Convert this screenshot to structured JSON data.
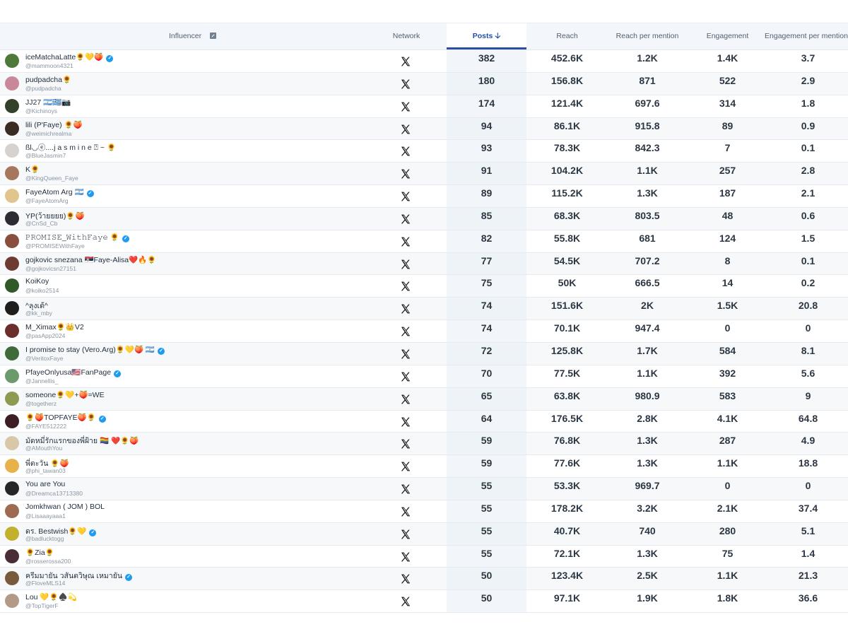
{
  "columns": {
    "influencer": "Influencer",
    "network": "Network",
    "posts": "Posts",
    "reach": "Reach",
    "reach_per_mention": "Reach per mention",
    "engagement": "Engagement",
    "engagement_per_mention": "Engagement per mention"
  },
  "sort": {
    "column": "posts",
    "direction": "desc"
  },
  "colors": {
    "accent": "#2b4f9e",
    "verified": "#1d9bf0"
  },
  "rows": [
    {
      "name": "iceMatchaLatte🌻💛🍑",
      "handle": "@mammoon4321",
      "verified": true,
      "posts": "382",
      "reach": "452.6K",
      "rpm": "1.2K",
      "eng": "1.4K",
      "epm": "3.7",
      "avatar": "#4d7a3a"
    },
    {
      "name": "pudpadcha🌻",
      "handle": "@pudpadcha",
      "verified": false,
      "posts": "180",
      "reach": "156.8K",
      "rpm": "871",
      "eng": "522",
      "epm": "2.9",
      "avatar": "#c9879a"
    },
    {
      "name": "JJ27 🇦🇷🇬🇷📷",
      "handle": "@Kichinoys",
      "verified": false,
      "posts": "174",
      "reach": "121.4K",
      "rpm": "697.6",
      "eng": "314",
      "epm": "1.8",
      "avatar": "#33402a"
    },
    {
      "name": "lili (P'Faye) 🌻🍑",
      "handle": "@weimichrealma",
      "verified": false,
      "posts": "94",
      "reach": "86.1K",
      "rpm": "915.8",
      "eng": "89",
      "epm": "0.9",
      "avatar": "#3a2b25"
    },
    {
      "name": "ßl◡ⓔ....j a s m i n e ⍰ ~ 🌻",
      "handle": "@BlueJasmin7",
      "verified": false,
      "posts": "93",
      "reach": "78.3K",
      "rpm": "842.3",
      "eng": "7",
      "epm": "0.1",
      "avatar": "#d5d2cf"
    },
    {
      "name": "K🌻",
      "handle": "@KingQueen_Faye",
      "verified": false,
      "posts": "91",
      "reach": "104.2K",
      "rpm": "1.1K",
      "eng": "257",
      "epm": "2.8",
      "avatar": "#a5775d"
    },
    {
      "name": "FayeAtom Arg 🇦🇷",
      "handle": "@FayeAtomArg",
      "verified": true,
      "posts": "89",
      "reach": "115.2K",
      "rpm": "1.3K",
      "eng": "187",
      "epm": "2.1",
      "avatar": "#e2c58d"
    },
    {
      "name": "YP(ว้ายยยย)🌻🍑",
      "handle": "@CnSd_Cb",
      "verified": false,
      "posts": "85",
      "reach": "68.3K",
      "rpm": "803.5",
      "eng": "48",
      "epm": "0.6",
      "avatar": "#2c2a33"
    },
    {
      "name": "𝙿𝚁𝙾𝙼𝙸𝚂𝙴_𝚆𝚒𝚝𝚑𝙵𝚊𝚢𝚎 🌻",
      "handle": "@PROMISEWithFaye",
      "verified": true,
      "posts": "82",
      "reach": "55.8K",
      "rpm": "681",
      "eng": "124",
      "epm": "1.5",
      "avatar": "#8a4f3c"
    },
    {
      "name": "gojkovic snezana 🇷🇸Faye-Alisa❤️🔥🌻",
      "handle": "@gojkovicsn27151",
      "verified": false,
      "posts": "77",
      "reach": "54.5K",
      "rpm": "707.2",
      "eng": "8",
      "epm": "0.1",
      "avatar": "#6e3b33"
    },
    {
      "name": "KoiKoy",
      "handle": "@koiko2514",
      "verified": false,
      "posts": "75",
      "reach": "50K",
      "rpm": "666.5",
      "eng": "14",
      "epm": "0.2",
      "avatar": "#2f5a28"
    },
    {
      "name": "^ลุงเต้^",
      "handle": "@kk_mby",
      "verified": false,
      "posts": "74",
      "reach": "151.6K",
      "rpm": "2K",
      "eng": "1.5K",
      "epm": "20.8",
      "avatar": "#1f1d1c"
    },
    {
      "name": "M_Ximax🌻👑V2",
      "handle": "@pasApp2024",
      "verified": false,
      "posts": "74",
      "reach": "70.1K",
      "rpm": "947.4",
      "eng": "0",
      "epm": "0",
      "avatar": "#6a2f2c"
    },
    {
      "name": "I promise to stay (Vero.Arg)🌻💛🍑 🇦🇷",
      "handle": "@VeritoxFaye",
      "verified": true,
      "posts": "72",
      "reach": "125.8K",
      "rpm": "1.7K",
      "eng": "584",
      "epm": "8.1",
      "avatar": "#3f6b3a"
    },
    {
      "name": "PfayeOnlyusa🇺🇸FanPage",
      "handle": "@Jannellis_",
      "verified": true,
      "posts": "70",
      "reach": "77.5K",
      "rpm": "1.1K",
      "eng": "392",
      "epm": "5.6",
      "avatar": "#6b9a6c"
    },
    {
      "name": "someone🌻💛+🍑=WE",
      "handle": "@togetherz",
      "verified": false,
      "posts": "65",
      "reach": "63.8K",
      "rpm": "980.9",
      "eng": "583",
      "epm": "9",
      "avatar": "#8c9a52"
    },
    {
      "name": "🌻🍑TOPFAYE🍑🌻",
      "handle": "@FAYE512222",
      "verified": true,
      "posts": "64",
      "reach": "176.5K",
      "rpm": "2.8K",
      "eng": "4.1K",
      "epm": "64.8",
      "avatar": "#3d1e23"
    },
    {
      "name": "มัดหมี่รักแรกของพี่ฝ้าย 🏳️‍🌈 ❤️🌻🍑",
      "handle": "@AMouthYou",
      "verified": false,
      "posts": "59",
      "reach": "76.8K",
      "rpm": "1.3K",
      "eng": "287",
      "epm": "4.9",
      "avatar": "#d9c8a8"
    },
    {
      "name": "พี่ตะวัน 🌻🍑",
      "handle": "@phi_tawan03",
      "verified": false,
      "posts": "59",
      "reach": "77.6K",
      "rpm": "1.3K",
      "eng": "1.1K",
      "epm": "18.8",
      "avatar": "#e8b24a"
    },
    {
      "name": "You are You",
      "handle": "@Dreamca13713380",
      "verified": false,
      "posts": "55",
      "reach": "53.3K",
      "rpm": "969.7",
      "eng": "0",
      "epm": "0",
      "avatar": "#262626"
    },
    {
      "name": "Jomkhwan ( JOM ) BOL",
      "handle": "@Lisaaayaaa1",
      "verified": false,
      "posts": "55",
      "reach": "178.2K",
      "rpm": "3.2K",
      "eng": "2.1K",
      "epm": "37.4",
      "avatar": "#9d6a52"
    },
    {
      "name": "ดร. Bestwish🌻💛",
      "handle": "@badlucktogg",
      "verified": true,
      "posts": "55",
      "reach": "40.7K",
      "rpm": "740",
      "eng": "280",
      "epm": "5.1",
      "avatar": "#c2b12d"
    },
    {
      "name": "🌻Zia🌻",
      "handle": "@rosserossa200",
      "verified": false,
      "posts": "55",
      "reach": "72.1K",
      "rpm": "1.3K",
      "eng": "75",
      "epm": "1.4",
      "avatar": "#4a2e36"
    },
    {
      "name": "ครีมมายัน วสันตวิษุณ เหมายัน",
      "handle": "@FloveMLS14",
      "verified": true,
      "posts": "50",
      "reach": "123.4K",
      "rpm": "2.5K",
      "eng": "1.1K",
      "epm": "21.3",
      "avatar": "#7a5a3c"
    },
    {
      "name": "Lou 💛🌻♠️💫",
      "handle": "@TopTigerF",
      "verified": false,
      "posts": "50",
      "reach": "97.1K",
      "rpm": "1.9K",
      "eng": "1.8K",
      "epm": "36.6",
      "avatar": "#b29a86"
    }
  ]
}
